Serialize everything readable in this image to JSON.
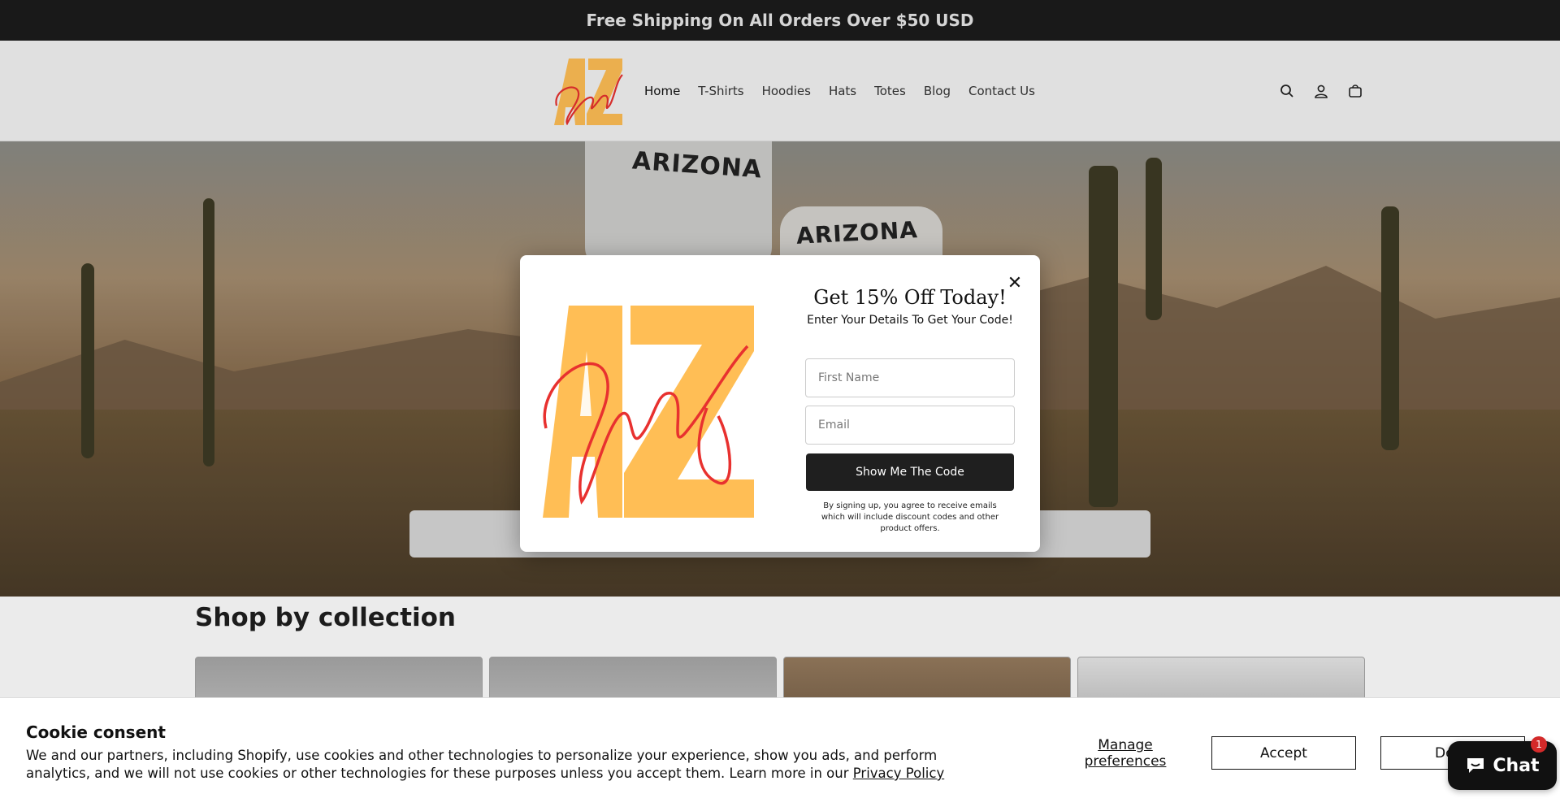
{
  "announcement": {
    "text": "Free Shipping On All Orders Over $50 USD"
  },
  "header": {
    "logo_text": "AZ Swag",
    "nav": [
      "Home",
      "T-Shirts",
      "Hoodies",
      "Hats",
      "Totes",
      "Blog",
      "Contact Us"
    ],
    "icons": [
      "search-icon",
      "account-icon",
      "cart-icon"
    ]
  },
  "hero": {
    "shirt_text": "ARIZONA"
  },
  "collections": {
    "title": "Shop by collection"
  },
  "popup": {
    "title": "Get 15% Off Today!",
    "subtitle": "Enter Your Details To Get Your Code!",
    "first_name_placeholder": "First Name",
    "email_placeholder": "Email",
    "button_label": "Show Me The Code",
    "disclaimer": "By signing up, you agree to receive emails which will include discount codes and other product offers.",
    "close_label": "✕"
  },
  "cookie": {
    "title": "Cookie consent",
    "text": "We and our partners, including Shopify, use cookies and other technologies to personalize your experience, show you ads, and perform analytics, and we will not use cookies or other technologies for these purposes unless you accept them. Learn more in our",
    "link_text": "Privacy Policy",
    "manage_label": "Manage preferences",
    "accept_label": "Accept",
    "decline_label": "Decline"
  },
  "chat": {
    "label": "Chat",
    "badge": "1"
  },
  "colors": {
    "brand_yellow": "#FFBE55",
    "brand_red": "#E8312F",
    "dark": "#1F1F1F"
  }
}
